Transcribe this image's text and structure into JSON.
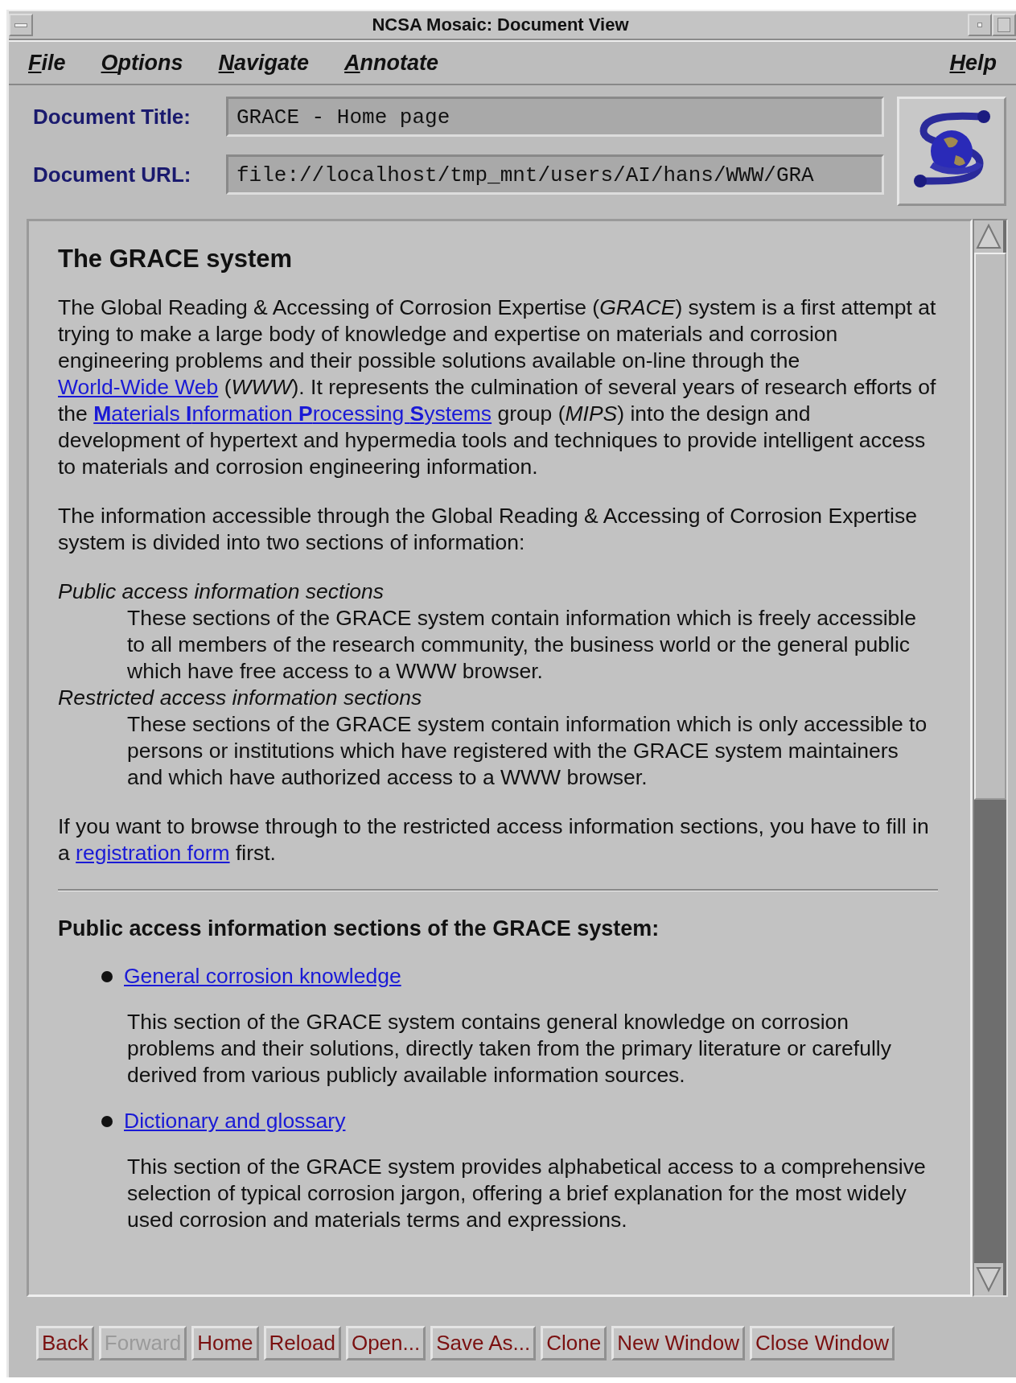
{
  "window": {
    "title": "NCSA Mosaic: Document View"
  },
  "menu": [
    {
      "label": "File",
      "mnemonic_underlined": true
    },
    {
      "label": "Options",
      "mnemonic_underlined": true
    },
    {
      "label": "Navigate",
      "mnemonic_underlined": true
    },
    {
      "label": "Annotate",
      "mnemonic_underlined": true
    },
    {
      "label": "Help",
      "mnemonic_underlined": true
    }
  ],
  "document_title": {
    "label": "Document Title:",
    "value": "GRACE - Home page"
  },
  "document_url": {
    "label": "Document URL:",
    "value": "file://localhost/tmp_mnt/users/AI/hans/WWW/GRA"
  },
  "content": [
    {
      "kind": "heading",
      "text": "The GRACE system"
    },
    {
      "kind": "paragraph",
      "segments": [
        {
          "kind": "text",
          "text": "The Global Reading & Accessing of Corrosion Expertise ("
        },
        {
          "kind": "italic",
          "text": "GRACE"
        },
        {
          "kind": "text",
          "text": ") system is a first attempt at trying to make a large body of knowledge and expertise on materials and corrosion engineering problems and their possible solutions available on-line through the "
        },
        {
          "kind": "link",
          "text": "World-Wide Web"
        },
        {
          "kind": "text",
          "text": " ("
        },
        {
          "kind": "italic",
          "text": "WWW"
        },
        {
          "kind": "text",
          "text": "). It represents the culmination of several years of research efforts of the "
        },
        {
          "kind": "link",
          "text": "**M**aterials **I**nformation **P**rocessing **S**ystems"
        },
        {
          "kind": "text",
          "text": " group ("
        },
        {
          "kind": "italic",
          "text": "MIPS"
        },
        {
          "kind": "text",
          "text": ") into the design and development of hypertext and hypermedia tools and techniques to provide intelligent access to materials and corrosion engineering information."
        }
      ]
    },
    {
      "kind": "paragraph",
      "segments": [
        {
          "kind": "text",
          "text": "The information accessible through the Global Reading & Accessing of Corrosion Expertise system is divided into two sections of information:"
        }
      ]
    },
    {
      "kind": "definitions",
      "items": [
        {
          "term": "Public access information sections",
          "definition": "These sections of the GRACE system contain information which is freely accessible to all members of the research community, the business world or the general public which have free access to a WWW browser."
        },
        {
          "term": "Restricted access information sections",
          "definition": "These sections of the GRACE system contain information which is only accessible to persons or institutions which have registered with the GRACE system maintainers and which have authorized access to a WWW browser."
        }
      ]
    },
    {
      "kind": "paragraph",
      "segments": [
        {
          "kind": "text",
          "text": "If you want to browse through to the restricted access information sections, you have to fill in a "
        },
        {
          "kind": "link",
          "text": "registration form"
        },
        {
          "kind": "text",
          "text": " first."
        }
      ]
    },
    {
      "kind": "rule"
    },
    {
      "kind": "subheading",
      "text": "Public access information sections of the GRACE system:"
    },
    {
      "kind": "bullets",
      "items": [
        {
          "link": "General corrosion knowledge",
          "description": "This section of the GRACE system contains general knowledge on corrosion problems and their solutions, directly taken from the primary literature or carefully derived from various publicly available information sources."
        },
        {
          "link": "Dictionary and glossary",
          "description": "This section of the GRACE system provides alphabetical access to a comprehensive selection of typical corrosion jargon, offering a brief explanation for the most widely used corrosion and materials terms and expressions."
        }
      ]
    }
  ],
  "buttons": [
    {
      "label": "Back",
      "disabled": false
    },
    {
      "label": "Forward",
      "disabled": true
    },
    {
      "label": "Home",
      "disabled": false
    },
    {
      "label": "Reload",
      "disabled": false
    },
    {
      "label": "Open...",
      "disabled": false
    },
    {
      "label": "Save As...",
      "disabled": false
    },
    {
      "label": "Clone",
      "disabled": false
    },
    {
      "label": "New Window",
      "disabled": false
    },
    {
      "label": "Close Window",
      "disabled": false
    }
  ]
}
